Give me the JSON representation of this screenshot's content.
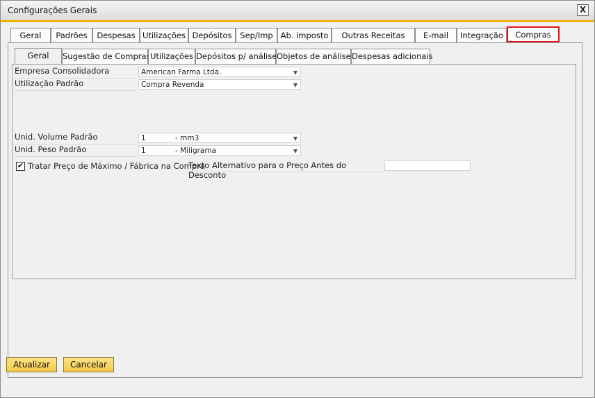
{
  "window": {
    "title": "Configurações Gerais",
    "close_label": "X"
  },
  "main_tabs": [
    {
      "label": "Geral"
    },
    {
      "label": "Padrões"
    },
    {
      "label": "Despesas"
    },
    {
      "label": "Utilizações"
    },
    {
      "label": "Depósitos"
    },
    {
      "label": "Sep/Imp"
    },
    {
      "label": "Ab. imposto"
    },
    {
      "label": "Outras Receitas"
    },
    {
      "label": "E-mail"
    },
    {
      "label": "Integração"
    },
    {
      "label": "Compras"
    }
  ],
  "sub_tabs": [
    {
      "label": "Geral"
    },
    {
      "label": "Sugestão de Compras"
    },
    {
      "label": "Utilizações"
    },
    {
      "label": "Depósitos p/ análise"
    },
    {
      "label": "Objetos de análise"
    },
    {
      "label": "Despesas adicionais"
    }
  ],
  "form": {
    "empresa": {
      "label": "Empresa Consolidadora",
      "value": "American Farma Ltda."
    },
    "utilizacao": {
      "label": "Utilização Padrão",
      "value": "Compra Revenda"
    },
    "volume": {
      "label": "Unid. Volume Padrão",
      "qty": "1",
      "unit": "- mm3"
    },
    "peso": {
      "label": "Unid. Peso Padrão",
      "qty": "1",
      "unit": "- Miligrama"
    },
    "tratar_preco": {
      "label": "Tratar Preço de Máximo / Fábrica na Compra",
      "checked_glyph": "✔"
    },
    "texto_alternativo": {
      "label": "Texto Alternativo para o Preço Antes do Desconto",
      "value": ""
    }
  },
  "buttons": {
    "update": "Atualizar",
    "cancel": "Cancelar"
  },
  "icons": {
    "dropdown": "chevron-down-icon",
    "close": "close-icon",
    "check": "checkmark-icon"
  },
  "colors": {
    "accent": "#f2b200",
    "highlight": "#e3151b",
    "button": "#f6c946"
  }
}
